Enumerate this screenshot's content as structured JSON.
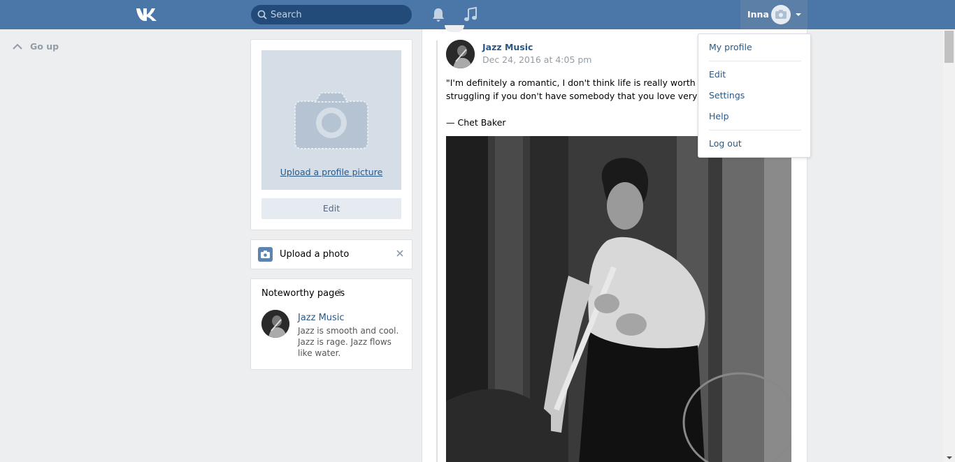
{
  "header": {
    "logo_icon": "vk-logo-icon",
    "search": {
      "placeholder": "Search"
    },
    "notifications_icon": "bell-icon",
    "music_icon": "music-note-icon",
    "user": {
      "name": "Inna"
    },
    "accent_color": "#4a76a8"
  },
  "go_up": {
    "label": "Go up"
  },
  "profile": {
    "upload_picture_label": "Upload a profile picture",
    "edit_label": "Edit"
  },
  "upload_photo": {
    "label": "Upload a photo"
  },
  "noteworthy": {
    "title": "Noteworthy pages",
    "count": "1",
    "pages": [
      {
        "name": "Jazz Music",
        "description": "Jazz is smooth and cool. Jazz is rage. Jazz flows like water."
      }
    ]
  },
  "post": {
    "author": "Jazz Music",
    "date": "Dec 24, 2016 at 4:05 pm",
    "text_line1": "\"I'm definitely a romantic, I don't think life is really worth all the",
    "text_line2": "struggling if you don't have somebody that you love very much.\"",
    "text_line3": "— Chet Baker"
  },
  "menu": {
    "items": [
      {
        "label": "My profile"
      },
      {
        "label": "Edit"
      },
      {
        "label": "Settings"
      },
      {
        "label": "Help"
      },
      {
        "label": "Log out"
      }
    ]
  }
}
